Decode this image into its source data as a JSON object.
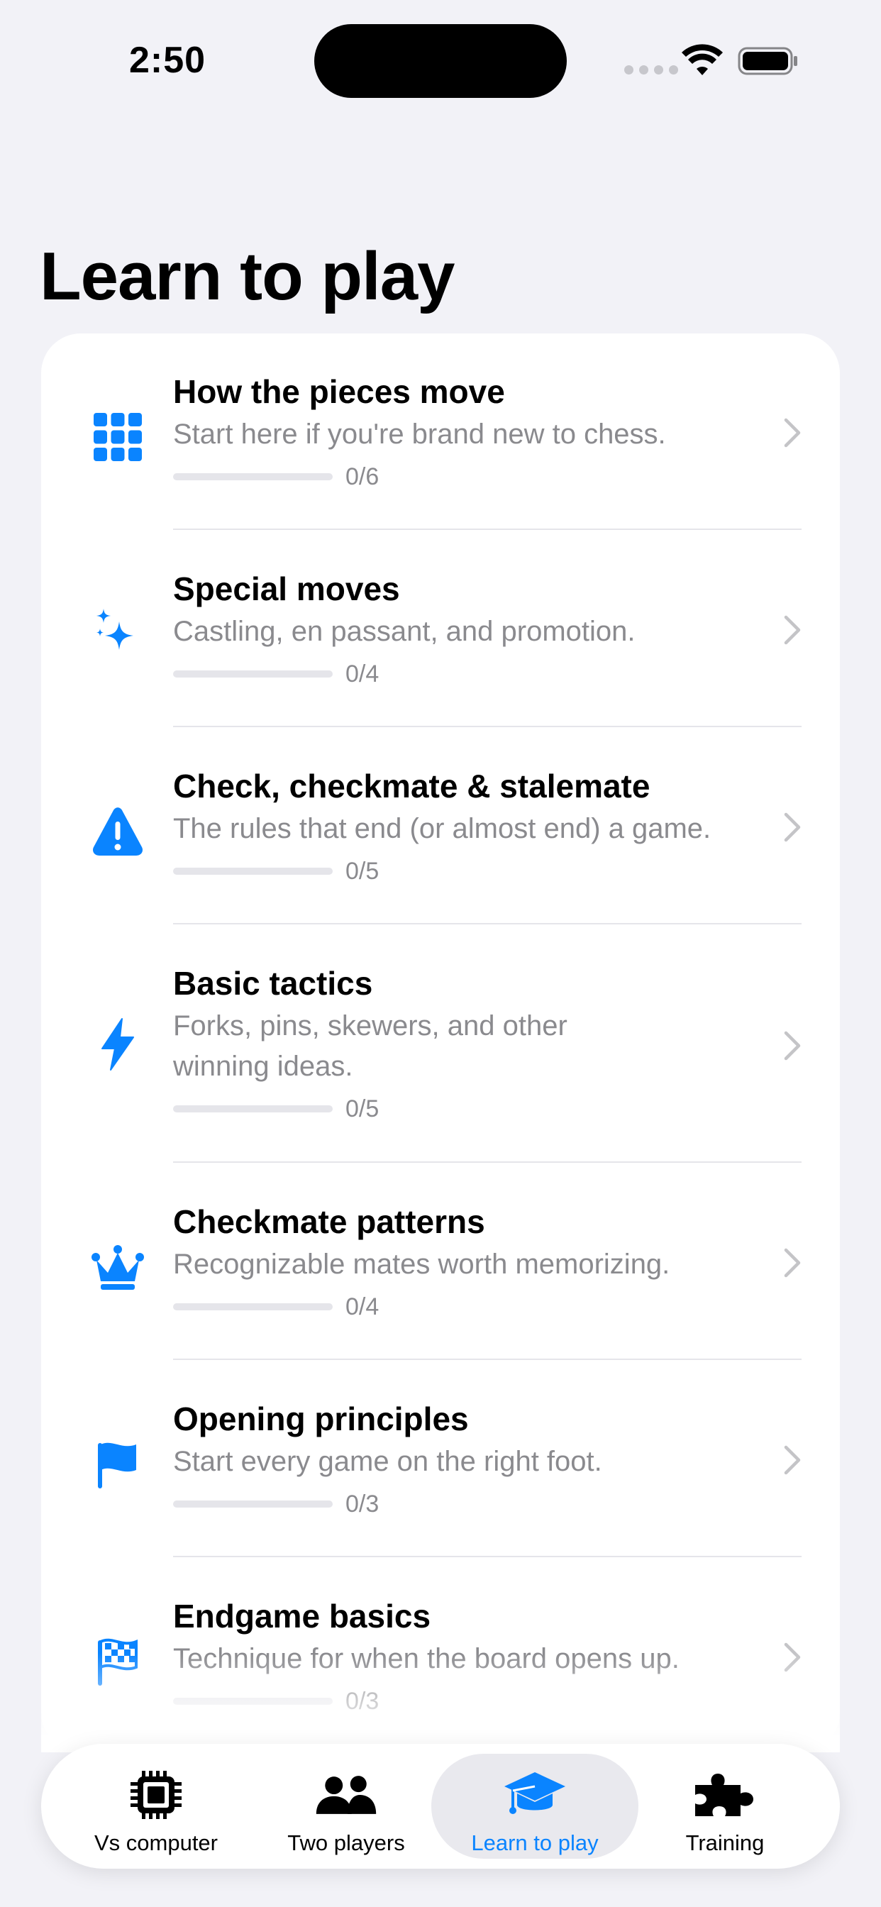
{
  "status_bar": {
    "time": "2:50"
  },
  "page": {
    "title": "Learn to play"
  },
  "lessons": [
    {
      "icon": "grid-icon",
      "title": "How the pieces move",
      "subtitle": "Start here if you're brand new to chess.",
      "progress": "0/6",
      "progress_fraction": 0
    },
    {
      "icon": "sparkles-icon",
      "title": "Special moves",
      "subtitle": "Castling, en passant, and promotion.",
      "progress": "0/4",
      "progress_fraction": 0
    },
    {
      "icon": "warning-triangle-icon",
      "title": "Check, checkmate & stalemate",
      "subtitle": "The rules that end (or almost end) a game.",
      "progress": "0/5",
      "progress_fraction": 0
    },
    {
      "icon": "lightning-bolt-icon",
      "title": "Basic tactics",
      "subtitle": "Forks, pins, skewers, and other winning ideas.",
      "progress": "0/5",
      "progress_fraction": 0
    },
    {
      "icon": "crown-icon",
      "title": "Checkmate patterns",
      "subtitle": "Recognizable mates worth memorizing.",
      "progress": "0/4",
      "progress_fraction": 0
    },
    {
      "icon": "flag-icon",
      "title": "Opening principles",
      "subtitle": "Start every game on the right foot.",
      "progress": "0/3",
      "progress_fraction": 0
    },
    {
      "icon": "checkered-flag-icon",
      "title": "Endgame basics",
      "subtitle": "Technique for when the board opens up.",
      "progress": "0/3",
      "progress_fraction": 0
    }
  ],
  "tabs": [
    {
      "icon": "cpu-chip-icon",
      "label": "Vs computer",
      "active": false
    },
    {
      "icon": "two-people-icon",
      "label": "Two players",
      "active": false
    },
    {
      "icon": "graduation-cap-icon",
      "label": "Learn to play",
      "active": true
    },
    {
      "icon": "puzzle-piece-icon",
      "label": "Training",
      "active": false
    }
  ],
  "colors": {
    "accent": "#0a84ff",
    "background": "#f2f2f7",
    "secondary_text": "#8a8a8e"
  }
}
